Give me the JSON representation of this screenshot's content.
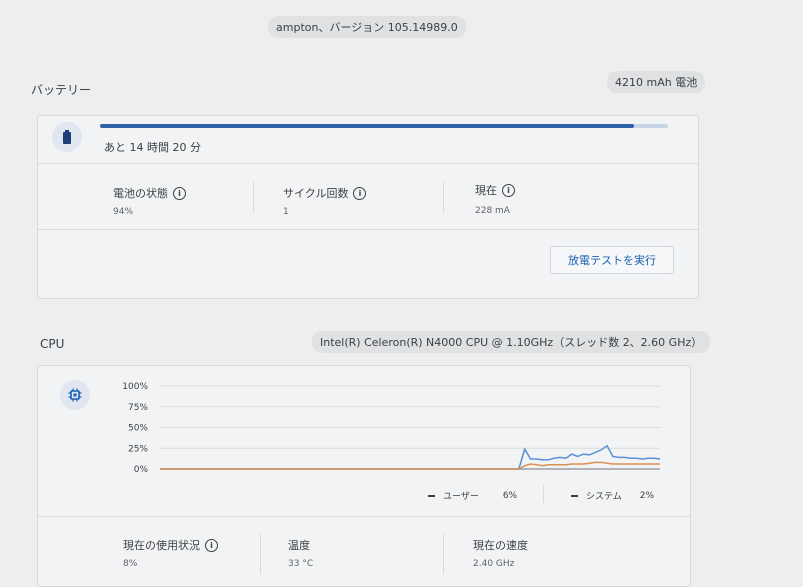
{
  "header": {
    "version": "ampton、バージョン 105.14989.0"
  },
  "battery": {
    "title": "バッテリー",
    "capacity": "4210 mAh 電池",
    "remaining": "あと 14 時間 20 分",
    "charge_level": 0.94,
    "stats": {
      "health_label": "電池の状態",
      "health_value": "94%",
      "cycle_label": "サイクル回数",
      "cycle_value": "1",
      "current_label": "現在",
      "current_value": "228 mA"
    },
    "discharge_button": "放電テストを実行"
  },
  "cpu": {
    "title": "CPU",
    "info": "Intel(R) Celeron(R) N4000 CPU @ 1.10GHz（スレッド数 2、2.60 GHz）",
    "chart_data": {
      "type": "line",
      "y_ticks": [
        "100%",
        "75%",
        "50%",
        "25%",
        "0%"
      ],
      "ylim": [
        0,
        100
      ],
      "grid": true,
      "series": [
        {
          "name": "ユーザー",
          "color": "#5b8fd6",
          "values": [
            0,
            0,
            0,
            0,
            0,
            0,
            0,
            0,
            0,
            0,
            0,
            0,
            0,
            0,
            0,
            0,
            0,
            0,
            0,
            0,
            0,
            0,
            0,
            0,
            0,
            0,
            0,
            0,
            0,
            0,
            0,
            0,
            0,
            0,
            0,
            0,
            0,
            0,
            0,
            0,
            0,
            0,
            0,
            0,
            0,
            0,
            0,
            0,
            0,
            0,
            0,
            0,
            0,
            0,
            0,
            0,
            0,
            0,
            0,
            0,
            0,
            0,
            24,
            12,
            12,
            11,
            11,
            13,
            14,
            13,
            18,
            15,
            18,
            17,
            20,
            23,
            28,
            15,
            14,
            14,
            13,
            13,
            12,
            13,
            13,
            12
          ]
        },
        {
          "name": "システム",
          "color": "#d99155",
          "values": [
            0,
            0,
            0,
            0,
            0,
            0,
            0,
            0,
            0,
            0,
            0,
            0,
            0,
            0,
            0,
            0,
            0,
            0,
            0,
            0,
            0,
            0,
            0,
            0,
            0,
            0,
            0,
            0,
            0,
            0,
            0,
            0,
            0,
            0,
            0,
            0,
            0,
            0,
            0,
            0,
            0,
            0,
            0,
            0,
            0,
            0,
            0,
            0,
            0,
            0,
            0,
            0,
            0,
            0,
            0,
            0,
            0,
            0,
            0,
            0,
            0,
            0,
            4,
            6,
            5,
            4,
            5,
            5,
            5,
            5,
            6,
            6,
            6,
            7,
            8,
            8,
            7,
            6,
            6,
            6,
            6,
            6,
            6,
            6,
            6,
            6
          ]
        }
      ]
    },
    "legend": {
      "user_label": "ユーザー",
      "user_value": "6%",
      "system_label": "システム",
      "system_value": "2%"
    },
    "stats": {
      "usage_label": "現在の使用状況",
      "usage_value": "8%",
      "temp_label": "温度",
      "temp_value": "33 °C",
      "speed_label": "現在の速度",
      "speed_value": "2.40 GHz"
    }
  }
}
